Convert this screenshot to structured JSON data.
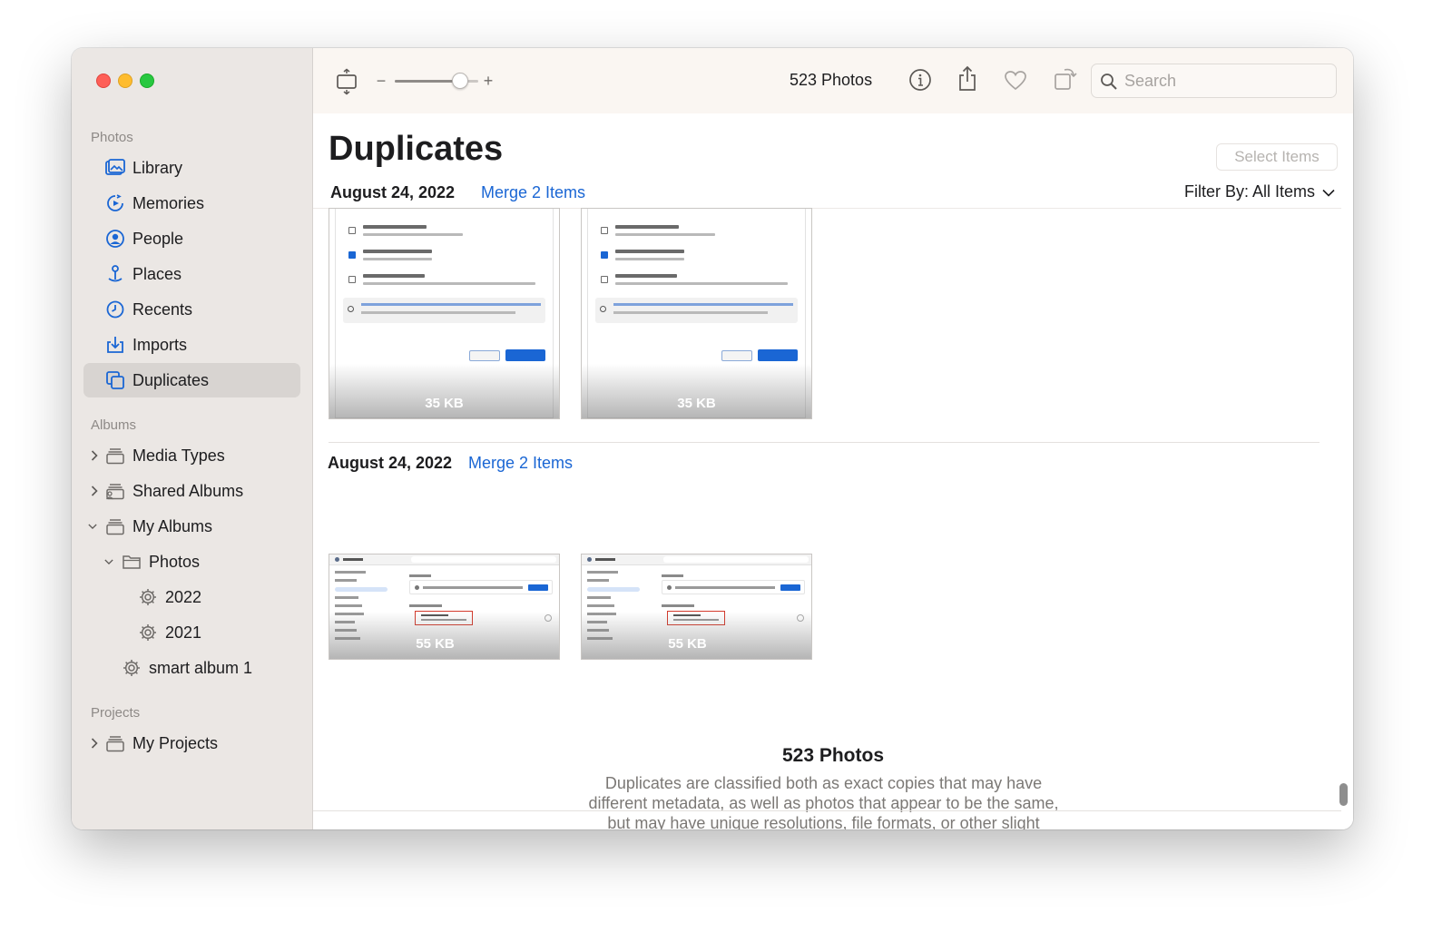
{
  "sidebar": {
    "photos_label": "Photos",
    "photos_items": [
      {
        "label": "Library",
        "icon": "library-icon"
      },
      {
        "label": "Memories",
        "icon": "memories-icon"
      },
      {
        "label": "People",
        "icon": "people-icon"
      },
      {
        "label": "Places",
        "icon": "places-icon"
      },
      {
        "label": "Recents",
        "icon": "recents-icon"
      },
      {
        "label": "Imports",
        "icon": "imports-icon"
      },
      {
        "label": "Duplicates",
        "icon": "duplicates-icon",
        "selected": true
      }
    ],
    "albums_label": "Albums",
    "albums_items": [
      {
        "label": "Media Types",
        "icon": "album-stack-icon",
        "expanded": false
      },
      {
        "label": "Shared Albums",
        "icon": "shared-album-icon",
        "expanded": false
      },
      {
        "label": "My Albums",
        "icon": "album-stack-icon",
        "expanded": true
      },
      {
        "label": "Photos",
        "icon": "folder-icon",
        "expanded": true
      },
      {
        "label": "2022",
        "icon": "smart-album-gear-icon"
      },
      {
        "label": "2021",
        "icon": "smart-album-gear-icon"
      },
      {
        "label": "smart album 1",
        "icon": "smart-album-gear-icon"
      }
    ],
    "projects_label": "Projects",
    "projects_items": [
      {
        "label": "My Projects",
        "icon": "album-stack-icon",
        "expanded": false
      }
    ]
  },
  "toolbar": {
    "zoom_minus": "−",
    "zoom_plus": "+",
    "zoom_level": 0.85,
    "photo_count": "523 Photos",
    "search_placeholder": "Search"
  },
  "main": {
    "title": "Duplicates",
    "select_items_label": "Select Items",
    "filter_label": "Filter By: All Items",
    "groups": [
      {
        "date": "August 24, 2022",
        "merge_label": "Merge 2 Items",
        "thumbs": [
          {
            "size": "35 KB"
          },
          {
            "size": "35 KB"
          }
        ]
      },
      {
        "date": "August 24, 2022",
        "merge_label": "Merge 2 Items",
        "thumbs": [
          {
            "size": "55 KB"
          },
          {
            "size": "55 KB"
          }
        ]
      }
    ],
    "footer_title": "523 Photos",
    "footer_desc": "Duplicates are classified both as exact copies that may have different metadata, as well as photos that appear to be the same, but may have unique resolutions, file formats, or other slight differences."
  },
  "colors": {
    "accent": "#1a66d4",
    "sidebar_bg": "#ebe7e4",
    "toolbar_bg": "#faf6f2",
    "selected_bg": "#d8d4d1"
  }
}
